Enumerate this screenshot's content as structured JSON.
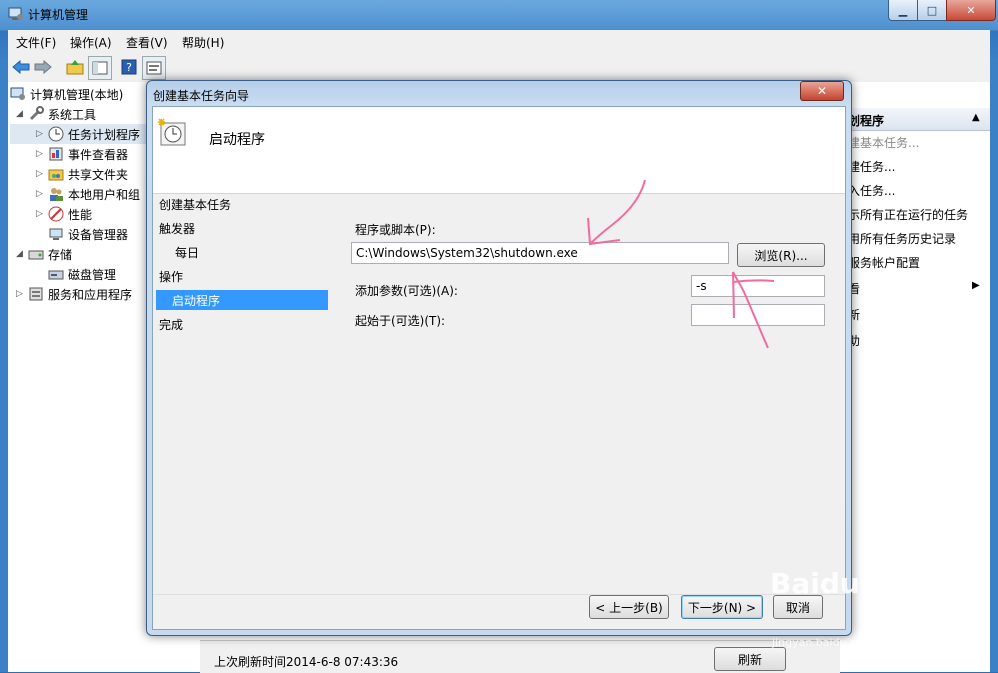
{
  "window": {
    "title": "计算机管理",
    "minimize": "▁",
    "maximize": "□",
    "close": "✕"
  },
  "menubar": {
    "items": [
      "文件(F)",
      "操作(A)",
      "查看(V)",
      "帮助(H)"
    ]
  },
  "toolbar": {
    "icons": [
      "back-arrow-icon",
      "forward-arrow-icon",
      "up-folder-icon",
      "show-hide-tree-icon",
      "help-icon",
      "properties-icon"
    ]
  },
  "tree": {
    "root": "计算机管理(本地)",
    "system_tools": "系统工具",
    "task_scheduler": "任务计划程序",
    "event_viewer": "事件查看器",
    "shared_folders": "共享文件夹",
    "local_users": "本地用户和组",
    "performance": "性能",
    "device_manager": "设备管理器",
    "storage": "存储",
    "disk_management": "磁盘管理",
    "services_apps": "服务和应用程序"
  },
  "actions": {
    "header": "划程序",
    "items": [
      "建基本任务...",
      "建任务...",
      "入任务...",
      "示所有正在运行的任务",
      "用所有任务历史记录",
      "服务帐户配置",
      "看",
      "新",
      "助"
    ]
  },
  "status": {
    "last_refresh": "上次刷新时间2014-6-8 07:43:36",
    "refresh_button": "刷新"
  },
  "dialog": {
    "title": "创建基本任务向导",
    "close": "✕",
    "header_title": "启动程序",
    "steps": {
      "create": "创建基本任务",
      "trigger": "触发器",
      "daily": "每日",
      "action": "操作",
      "start_program": "启动程序",
      "finish": "完成"
    },
    "program_label": "程序或脚本(P):",
    "program_value": "C:\\Windows\\System32\\shutdown.exe",
    "browse_button": "浏览(R)...",
    "args_label": "添加参数(可选)(A):",
    "args_value": "-s",
    "startin_label": "起始于(可选)(T):",
    "startin_value": "",
    "back_button": "< 上一步(B)",
    "next_button": "下一步(N) >",
    "cancel_button": "取消"
  },
  "watermark": {
    "logo": "Baidu 经验",
    "url": "jingyan.baidu.com"
  },
  "colors": {
    "selection": "#3399ff",
    "annotation": "#f06ca0",
    "title_gradient": "#4e8fcf"
  }
}
